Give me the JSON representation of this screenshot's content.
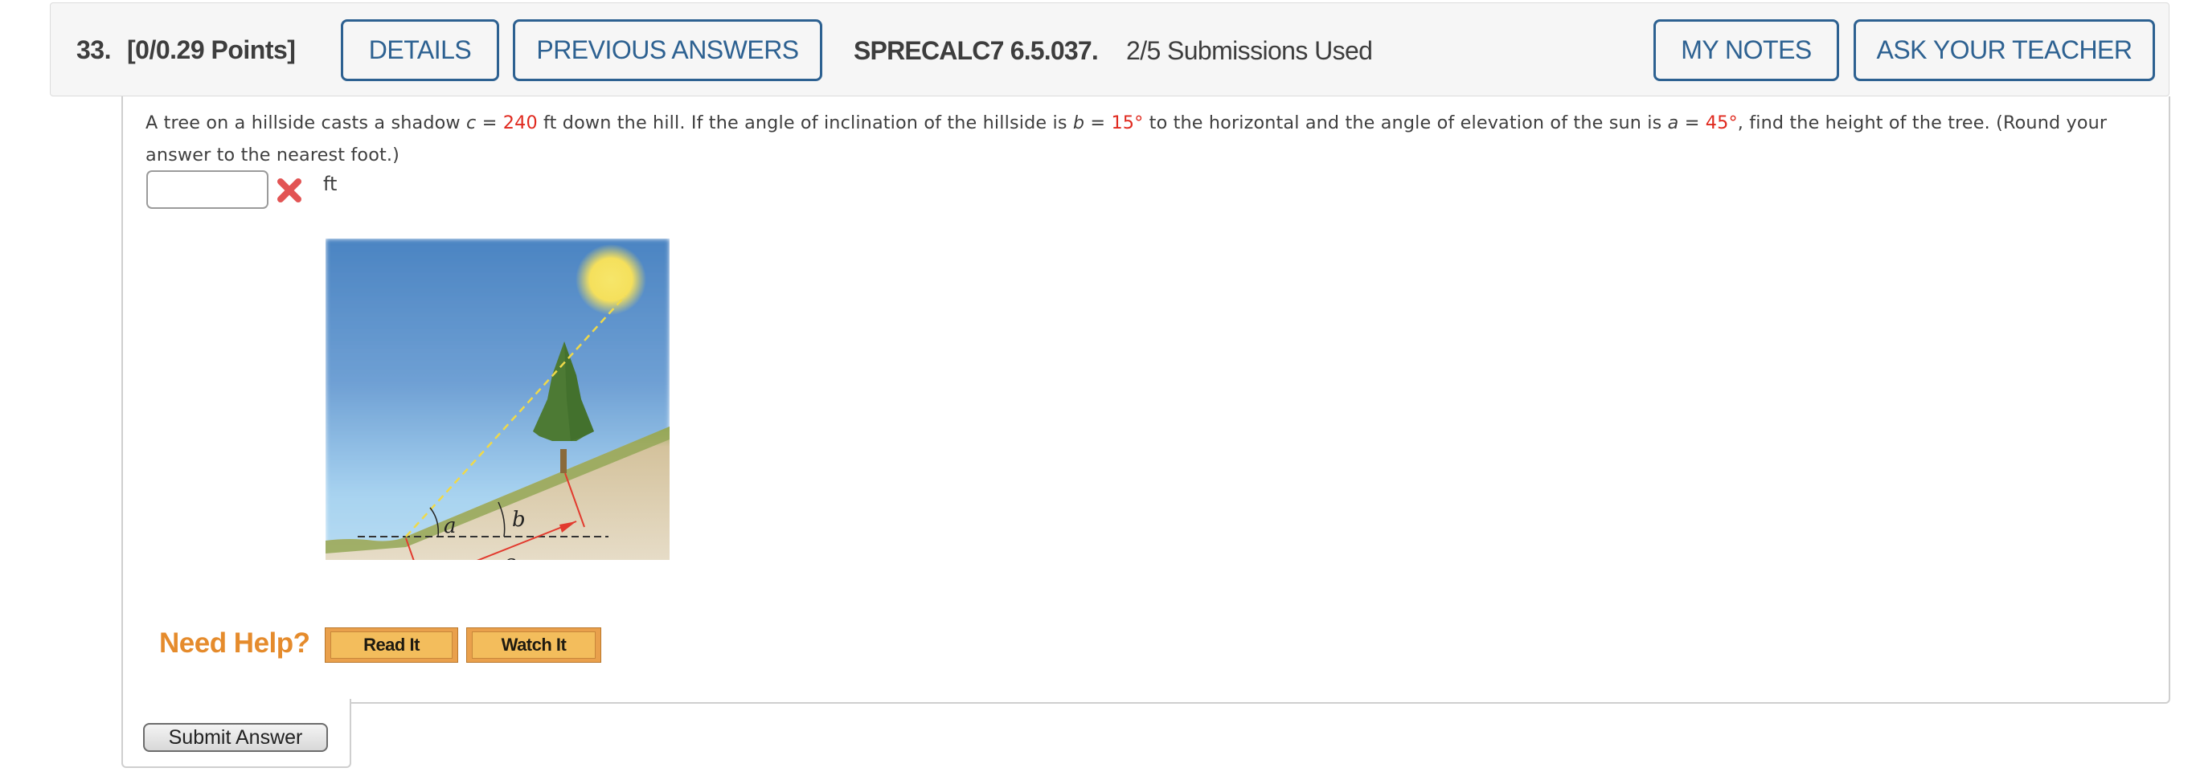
{
  "header": {
    "question_number": "33.",
    "points": "[0/0.29 Points]",
    "buttons": {
      "details": "DETAILS",
      "previous_answers": "PREVIOUS ANSWERS",
      "my_notes": "MY NOTES",
      "ask_teacher": "ASK YOUR TEACHER"
    },
    "question_id": "SPRECALC7 6.5.037.",
    "submissions": "2/5 Submissions Used"
  },
  "problem": {
    "part1": "A tree on a hillside casts a shadow ",
    "var_c": "c",
    "eq1": " = ",
    "value_c": "240",
    "part2": " ft down the hill. If the angle of inclination of the hillside is ",
    "var_b": "b",
    "eq2": " = ",
    "value_b": "15°",
    "part3": " to the horizontal and the angle of elevation of the sun is ",
    "var_a": "a",
    "eq3": " = ",
    "value_a": "45°",
    "part4": ", find the height of the tree. (Round your answer to the nearest foot.)"
  },
  "answer": {
    "value": "",
    "status_icon": "incorrect-x-icon",
    "unit": "ft"
  },
  "figure": {
    "label_a": "a",
    "label_b": "b",
    "label_c": "c"
  },
  "help": {
    "label": "Need Help?",
    "read_it": "Read It",
    "watch_it": "Watch It"
  },
  "submit": {
    "label": "Submit Answer"
  },
  "colors": {
    "accent_blue": "#2d6191",
    "value_red": "#e02a1f",
    "help_orange": "#e58b2c"
  }
}
